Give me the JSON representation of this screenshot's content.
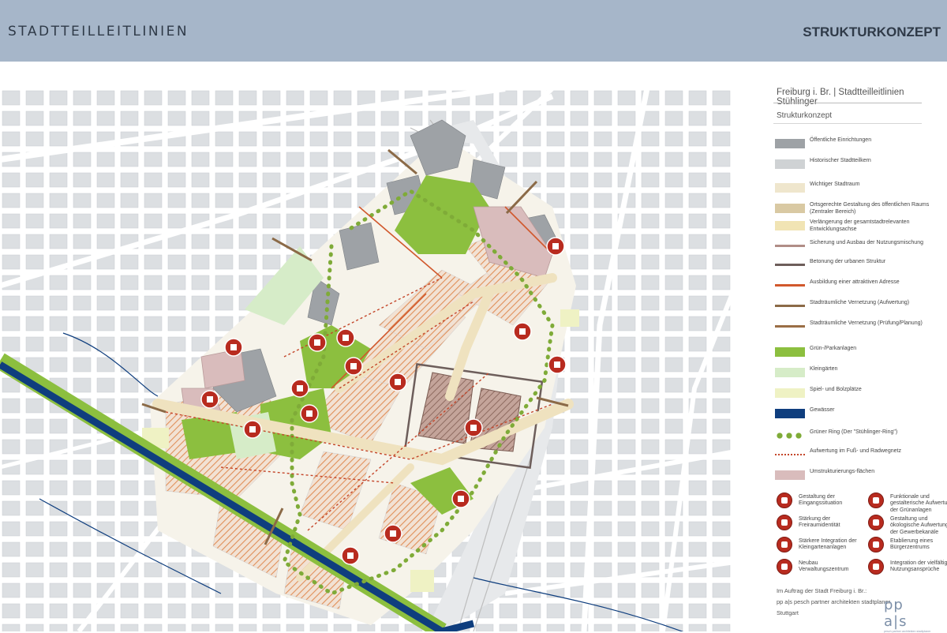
{
  "header": {
    "left_title": "STADTTEILLEITLINIEN",
    "right_title": "STRUKTURKONZEPT"
  },
  "legend": {
    "title": "Freiburg i. Br. | Stadtteilleitlinien Stühlinger",
    "subtitle": "Strukturkonzept",
    "items": [
      {
        "label": "Öffentliche Einrichtungen",
        "color": "#9ea2a6"
      },
      {
        "label": "Historischer Stadtteilkern",
        "color": "#cfd2d4"
      },
      {
        "label": "Wichtiger Stadtraum",
        "color": "#efe6cd"
      },
      {
        "label": "Ortsgerechte Gestaltung des öffentlichen Raums (Zentraler Bereich)",
        "color": "#d9c9a3"
      },
      {
        "label": "Verlängerung der gesamtstadtrelevanten Entwicklungsachse",
        "color": "#f1e4b4"
      },
      {
        "label": "Sicherung und Ausbau der Nutzungsmischung",
        "color": "#b08d86"
      },
      {
        "label": "Betonung der urbanen Struktur",
        "color": "#6d5e5b"
      },
      {
        "label": "Ausbildung einer attraktiven Adresse",
        "color": "#d1582c"
      },
      {
        "label": "Stadträumliche Vernetzung (Aufwertung)",
        "color": "#8b6a47"
      },
      {
        "label": "Stadträumliche Vernetzung (Prüfung/Planung)",
        "color": "#9a6e45"
      },
      {
        "label": "Grün-/Parkanlagen",
        "color": "#8cbf3f"
      },
      {
        "label": "Kleingärten",
        "color": "#d6ecc8"
      },
      {
        "label": "Spiel- und Bolzplätze",
        "color": "#eff2c4"
      },
      {
        "label": "Gewässer",
        "color": "#0f3e7e"
      },
      {
        "label": "Grüner Ring (Der \"Stühlinger-Ring\")",
        "color": "#7fab38"
      },
      {
        "label": "Aufwertung im Fuß- und Radwegnetz",
        "color": "#c4462a"
      },
      {
        "label": "Umstrukturierungs-flächen",
        "color": "#d9bcbc"
      }
    ],
    "icons": [
      {
        "label": "Gestaltung der Eingangssituation",
        "icon": "gateway-icon"
      },
      {
        "label": "Funktionale und gestalterische Aufwertung der Grünanlagen",
        "icon": "park-upgrade-icon"
      },
      {
        "label": "Stärkung der Freiraumidentität",
        "icon": "open-space-icon"
      },
      {
        "label": "Gestaltung und ökologische Aufwertung der Gewerbekanäle",
        "icon": "canal-icon"
      },
      {
        "label": "Stärkere Integration der Kleingartenanlagen",
        "icon": "allotment-icon"
      },
      {
        "label": "Etablierung eines Bürgerzentrums",
        "icon": "civic-center-icon"
      },
      {
        "label": "Neubau Verwaltungszentrum",
        "icon": "admin-center-icon"
      },
      {
        "label": "Integration der vielfältigen Nutzungsansprüche",
        "icon": "mixed-use-icon"
      }
    ],
    "credits": [
      "Im Auftrag der Stadt Freiburg i. Br.:",
      "pp a|s pesch partner architekten stadtplaner",
      "Stuttgart"
    ],
    "logo_text": "pp a|s",
    "logo_subtext": "pesch partner architekten stadtplaner"
  },
  "colors": {
    "header": "#a6b6c9",
    "background_map": "#f2f2f2",
    "streets": "#ffffff",
    "blocks": "#d9dcdf",
    "buildings_public": "#9ea2a6",
    "green": "#8cbf3f",
    "water": "#0f3e7e",
    "icon_red": "#b82b1f"
  }
}
